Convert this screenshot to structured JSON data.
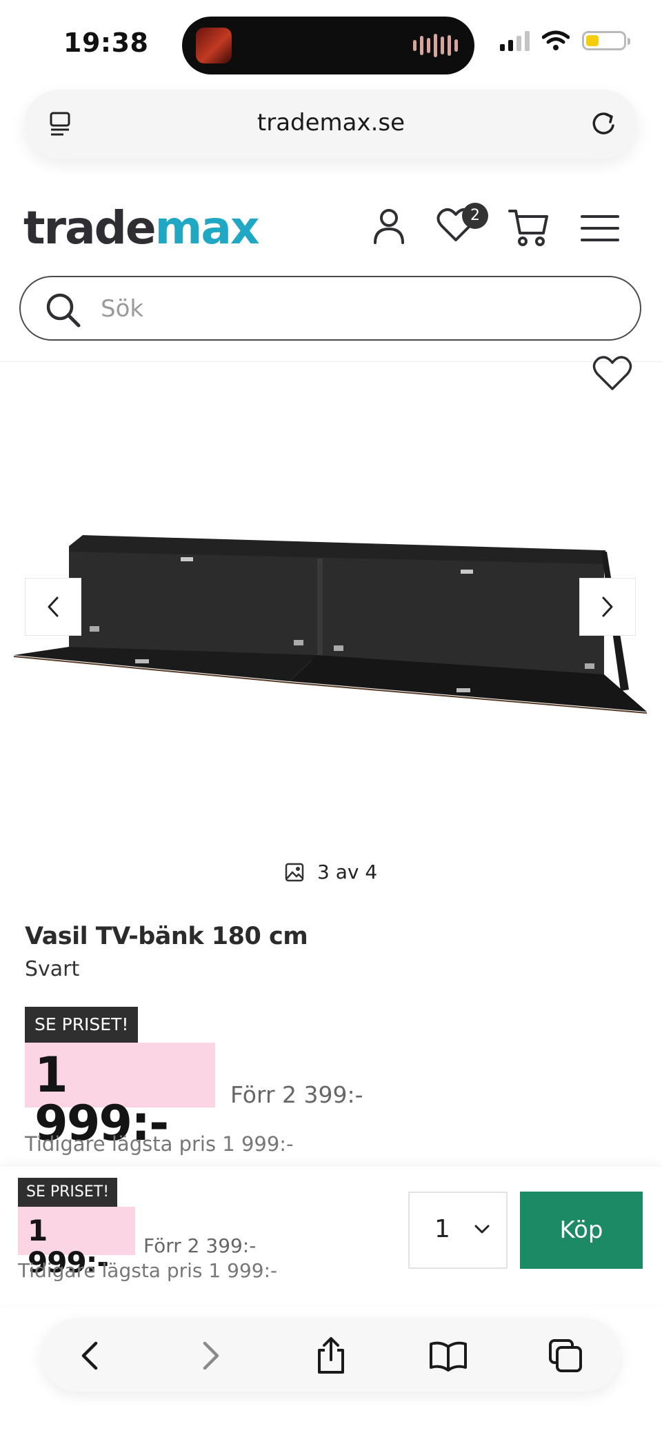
{
  "status_bar": {
    "time": "19:38",
    "battery_level": 0.3,
    "signal_bars_active": 2,
    "signal_bars_total": 4
  },
  "browser": {
    "url": "trademax.se"
  },
  "site": {
    "logo_part1": "trade",
    "logo_part2": "max",
    "wishlist_count": "2",
    "search_placeholder": "Sök",
    "colors": {
      "logo_dark": "#2f2f33",
      "logo_accent": "#1fa7c4",
      "price_highlight": "#fcd5e5",
      "buy_button": "#1d8a66"
    }
  },
  "gallery": {
    "counter": "3 av 4",
    "current_image": 3,
    "total_images": 4
  },
  "product": {
    "title": "Vasil TV-bänk 180 cm",
    "color": "Svart",
    "promo_tag": "SE PRISET!",
    "price": "1 999:-",
    "was_price": "Förr 2 399:-",
    "lowest_price": "Tidigare lägsta pris 1 999:-"
  },
  "buy_bar": {
    "promo_tag": "SE PRISET!",
    "price": "1 999:-",
    "was_price": "Förr 2 399:-",
    "lowest_price": "Tidigare lägsta pris 1 999:-",
    "quantity": "1",
    "buy_label": "Köp"
  },
  "toolbar": {
    "icons": [
      "back-icon",
      "forward-icon",
      "share-icon",
      "bookmarks-icon",
      "tabs-icon"
    ]
  }
}
